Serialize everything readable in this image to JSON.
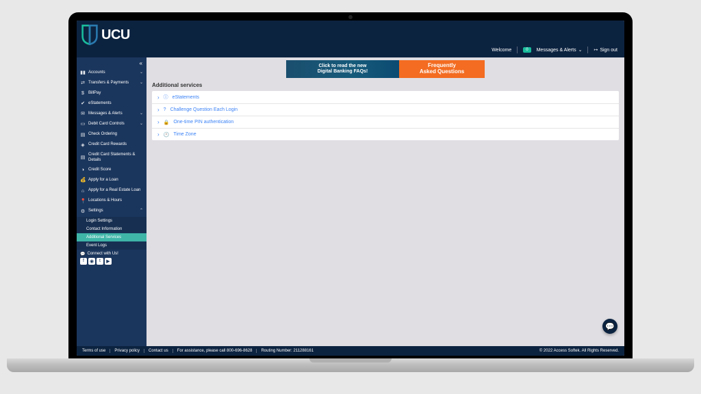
{
  "brand": {
    "name": "UCU"
  },
  "topbar": {
    "welcome": "Welcome",
    "badge": "0",
    "messages": "Messages & Alerts",
    "signout": "Sign out"
  },
  "sidebar": {
    "collapse_glyph": "«",
    "items": [
      {
        "icon": "bar-chart-icon",
        "glyph": "▮▮",
        "label": "Accounts",
        "expandable": true
      },
      {
        "icon": "transfers-icon",
        "glyph": "⇄",
        "label": "Transfers & Payments",
        "expandable": true
      },
      {
        "icon": "dollar-icon",
        "glyph": "$",
        "label": "BillPay",
        "expandable": false
      },
      {
        "icon": "check-icon",
        "glyph": "✔",
        "label": "eStatements",
        "expandable": false
      },
      {
        "icon": "mail-icon",
        "glyph": "✉",
        "label": "Messages & Alerts",
        "expandable": true
      },
      {
        "icon": "card-icon",
        "glyph": "▭",
        "label": "Debit Card Controls",
        "expandable": true
      },
      {
        "icon": "file-icon",
        "glyph": "▤",
        "label": "Check Ordering",
        "expandable": false
      },
      {
        "icon": "tag-icon",
        "glyph": "◈",
        "label": "Credit Card Rewards",
        "expandable": false
      },
      {
        "icon": "file-icon",
        "glyph": "▤",
        "label": "Credit Card Statements & Details",
        "expandable": false
      },
      {
        "icon": "gauge-icon",
        "glyph": "◑",
        "label": "Credit Score",
        "expandable": false
      },
      {
        "icon": "money-icon",
        "glyph": "💰",
        "label": "Apply for a Loan",
        "expandable": false
      },
      {
        "icon": "home-icon",
        "glyph": "⌂",
        "label": "Apply for a Real Estate Loan",
        "expandable": false
      },
      {
        "icon": "pin-icon",
        "glyph": "📍",
        "label": "Locations & Hours",
        "expandable": false
      },
      {
        "icon": "gear-icon",
        "glyph": "⚙",
        "label": "Settings",
        "expandable": true,
        "expanded": true
      }
    ],
    "subs": [
      {
        "label": "Login Settings",
        "active": false
      },
      {
        "label": "Contact Information",
        "active": false
      },
      {
        "label": "Additional Services",
        "active": true
      },
      {
        "label": "Event Logs",
        "active": false
      }
    ],
    "connect_label": "Connect with Us!"
  },
  "banner": {
    "line1": "Click to read the new",
    "line2": "Digital Banking FAQs!",
    "right1": "Frequently",
    "right2": "Asked Questions"
  },
  "section_title": "Additional services",
  "rows": [
    {
      "icon": "info-icon",
      "glyph": "ⓘ",
      "label": "eStatements"
    },
    {
      "icon": "question-icon",
      "glyph": "?",
      "label": "Challenge Question Each Login"
    },
    {
      "icon": "lock-icon",
      "glyph": "🔒",
      "label": "One-time PIN authentication"
    },
    {
      "icon": "clock-icon",
      "glyph": "🕐",
      "label": "Time Zone"
    }
  ],
  "footer": {
    "links": [
      "Terms of use",
      "Privacy policy",
      "Contact us",
      "For assistance, please call 800-696-8628",
      "Routing Number: 211288161"
    ],
    "copyright": "© 2022 Access Softek. All Rights Reserved."
  }
}
